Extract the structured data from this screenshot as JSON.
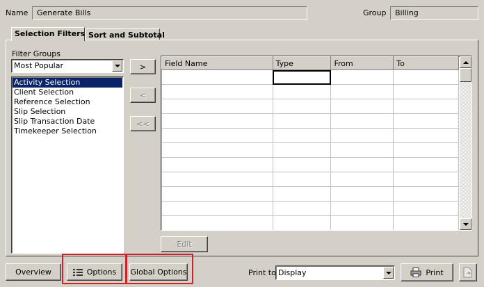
{
  "header": {
    "name_label": "Name",
    "name_value": "Generate Bills",
    "group_label": "Group",
    "group_value": "Billing"
  },
  "tabs": [
    {
      "label": "Selection Filters",
      "active": true
    },
    {
      "label": "Sort and Subtotal",
      "active": false
    }
  ],
  "filter_groups": {
    "label": "Filter Groups",
    "selected": "Most Popular",
    "items": [
      "Activity Selection",
      "Client Selection",
      "Reference Selection",
      "Slip Selection",
      "Slip Transaction Date",
      "Timekeeper Selection"
    ],
    "selected_index": 0
  },
  "move_buttons": {
    "add": ">",
    "remove": "<",
    "remove_all": "<<"
  },
  "grid": {
    "columns": [
      "Field Name",
      "Type",
      "From",
      "To"
    ],
    "row_count": 11
  },
  "edit_button": "Edit",
  "footer": {
    "overview": "Overview",
    "options": "Options",
    "global_options": "Global Options",
    "print_to_label": "Print to",
    "print_to_value": "Display",
    "print": "Print"
  },
  "colors": {
    "highlight": "#d0202a",
    "selection": "#0a246a",
    "face": "#d4d0c8"
  }
}
